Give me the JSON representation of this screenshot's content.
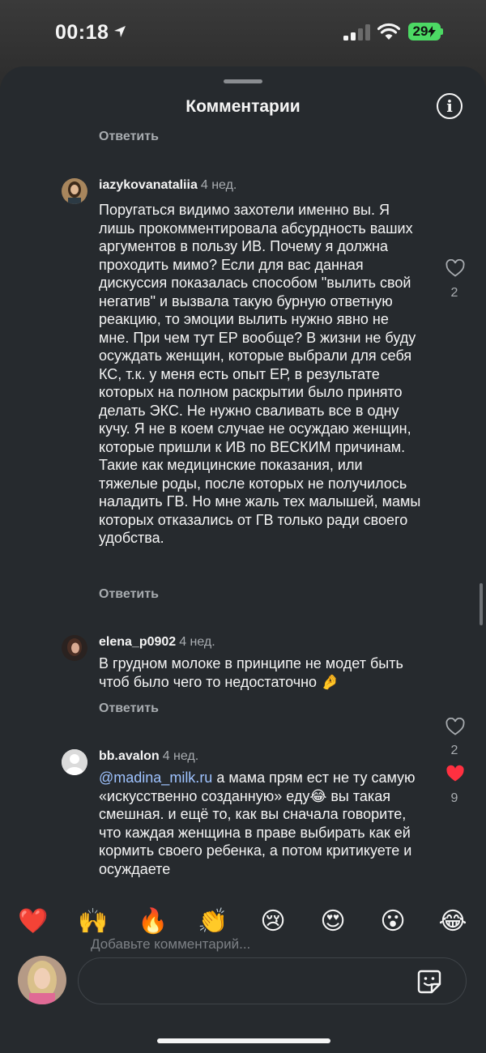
{
  "status_bar": {
    "time": "00:18",
    "battery": "29"
  },
  "sheet": {
    "title": "Комментарии"
  },
  "reply_label": "Ответить",
  "comments": [
    {
      "username": "iazykovanataliia",
      "ago": "4 нед.",
      "text": "Поругаться видимо захотели именно вы. Я лишь прокомментировала абсурдность ваших аргументов в пользу ИВ. Почему я должна проходить мимо? Если для вас данная дискуссия показалась способом \"вылить свой негатив\" и вызвала такую бурную ответную реакцию, то эмоции вылить нужно явно не мне. При чем тут ЕР вообще? В жизни не буду осуждать женщин, которые выбрали для себя КС, т.к. у меня есть опыт ЕР, в результате которых на полном раскрытии было принято делать ЭКС. Не нужно сваливать все в одну кучу. Я не в коем случае не осуждаю женщин, которые пришли к ИВ по ВЕСКИМ причинам. Такие как медицинские показания, или тяжелые роды, после которых не получилось наладить ГВ. Но мне жаль тех малышей, мамы которых отказались от ГВ только ради своего удобства.",
      "likes": "2",
      "liked": false
    },
    {
      "username": "elena_p0902",
      "ago": "4 нед.",
      "text": "В грудном молоке в принципе не модет быть чтоб было чего то недостаточно 🤌",
      "likes": "2",
      "liked": false
    },
    {
      "username": "bb.avalon",
      "ago": "4 нед.",
      "mention": "@madina_milk.ru",
      "text": " а мама прям ест не ту самую «искусственно созданную» еду😂 вы такая смешная. и ещё то, как вы сначала говорите, что каждая женщина в праве выбирать как ей кормить своего ребенка, а потом критикуете и осуждаете",
      "likes": "9",
      "liked": true
    }
  ],
  "emoji_bar": [
    "❤️",
    "🙌",
    "🔥",
    "👏",
    "😢",
    "😍",
    "😮",
    "😂"
  ],
  "composer": {
    "placeholder": "Добавьте комментарий..."
  },
  "colors": {
    "like_active": "#ff3040",
    "mention": "#9fc3ff",
    "battery": "#4cd964"
  }
}
